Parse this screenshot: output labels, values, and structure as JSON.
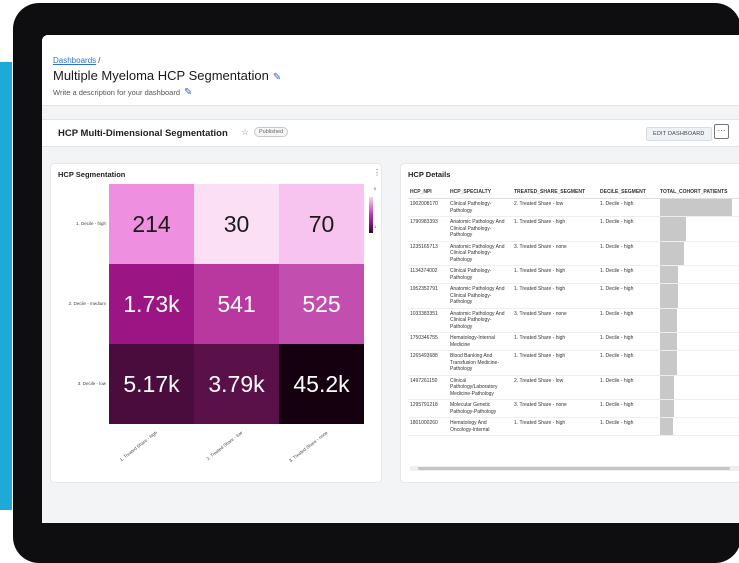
{
  "header": {
    "breadcrumb": "Dashboards",
    "breadcrumb_sep": "/",
    "title": "Multiple Myeloma HCP Segmentation",
    "description": "Write a description for your dashboard"
  },
  "dashbar": {
    "title": "HCP Multi-Dimensional Segmentation",
    "badge": "Published",
    "edit_label": "EDIT DASHBOARD",
    "more_label": "···"
  },
  "heatmap": {
    "title": "HCP Segmentation",
    "menu": "⋮",
    "y_labels": [
      "1. Decile - high",
      "2. Decile - medium",
      "3. Decile - low"
    ],
    "x_labels": [
      "1. Treated Share - high",
      "2. Treated Share - low",
      "3. Treated Share - none"
    ],
    "cells": [
      [
        "214",
        "30",
        "70"
      ],
      [
        "1.73k",
        "541",
        "525"
      ],
      [
        "5.17k",
        "3.79k",
        "45.2k"
      ]
    ],
    "colors": [
      [
        "#ee8fe0",
        "#fbe0f5",
        "#f6c4ee"
      ],
      [
        "#9b1684",
        "#b8389f",
        "#c24fb0"
      ],
      [
        "#4a0b3d",
        "#5a1049",
        "#150010"
      ]
    ],
    "colorbar_ticks": [
      "0",
      "1"
    ]
  },
  "details": {
    "title": "HCP Details",
    "menu": "⋮",
    "columns": [
      "HCP_NPI",
      "HCP_SPECIALTY",
      "TREATED_SHARE_SEGMENT",
      "DECILE_SEGMENT",
      "TOTAL_COHORT_PATIENTS"
    ],
    "rows": [
      {
        "npi": "1902008170",
        "specialty": "Clinical Pathology-Pathology",
        "treated": "2. Treated Share - low",
        "decile": "1. Decile - high",
        "total": "",
        "bar": 1.0
      },
      {
        "npi": "1790983393",
        "specialty": "Anatomic Pathology And Clinical Pathology-Pathology",
        "treated": "1. Treated Share - high",
        "decile": "1. Decile - high",
        "total": "5.",
        "bar": 0.36
      },
      {
        "npi": "1235165713",
        "specialty": "Anatomic Pathology And Clinical Pathology-Pathology",
        "treated": "3. Treated Share - none",
        "decile": "1. Decile - high",
        "total": "5.",
        "bar": 0.33
      },
      {
        "npi": "1134374002",
        "specialty": "Clinical Pathology-Pathology",
        "treated": "1. Treated Share - high",
        "decile": "1. Decile - high",
        "total": "4.",
        "bar": 0.25
      },
      {
        "npi": "1952352791",
        "specialty": "Anatomic Pathology And Clinical Pathology-Pathology",
        "treated": "1. Treated Share - high",
        "decile": "1. Decile - high",
        "total": "4.",
        "bar": 0.25
      },
      {
        "npi": "1033383351",
        "specialty": "Anatomic Pathology And Clinical Pathology-Pathology",
        "treated": "3. Treated Share - none",
        "decile": "1. Decile - high",
        "total": "4",
        "bar": 0.24
      },
      {
        "npi": "1750346755",
        "specialty": "Hematology-Internal Medicine",
        "treated": "1. Treated Share - high",
        "decile": "1. Decile - high",
        "total": "4.",
        "bar": 0.23
      },
      {
        "npi": "1265493688",
        "specialty": "Blood Banking And Transfusion Medicine-Pathology",
        "treated": "1. Treated Share - high",
        "decile": "1. Decile - high",
        "total": "4.",
        "bar": 0.23
      },
      {
        "npi": "1497261150",
        "specialty": "Clinical Pathology/Laboratory Medicine-Pathology",
        "treated": "2. Treated Share - low",
        "decile": "1. Decile - high",
        "total": "3.",
        "bar": 0.2
      },
      {
        "npi": "1295791218",
        "specialty": "Molecular Genetic Pathology-Pathology",
        "treated": "3. Treated Share - none",
        "decile": "1. Decile - high",
        "total": "3.",
        "bar": 0.19
      },
      {
        "npi": "1801000260",
        "specialty": "Hematology And Oncology-Internal",
        "treated": "1. Treated Share - high",
        "decile": "1. Decile - high",
        "total": "3.",
        "bar": 0.18
      }
    ]
  }
}
